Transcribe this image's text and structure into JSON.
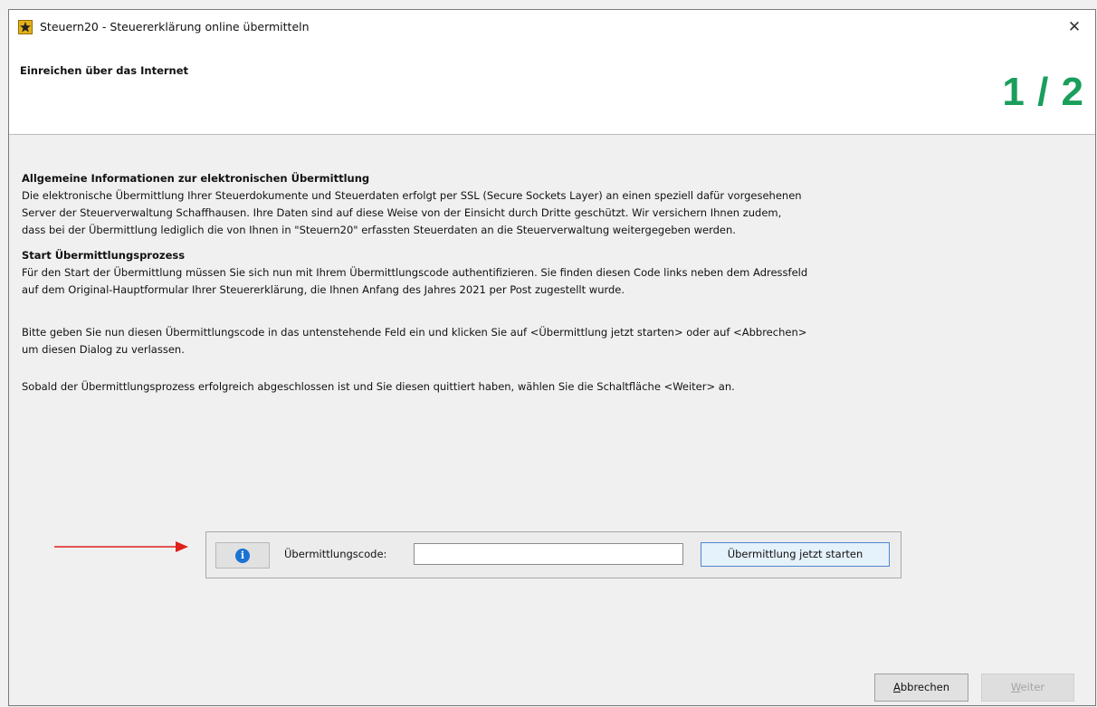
{
  "window": {
    "title": "Steuern20 - Steuererklärung online übermitteln",
    "close_label": "✕"
  },
  "header": {
    "title": "Einreichen über das Internet",
    "step": "1 / 2"
  },
  "content": {
    "section1": {
      "heading": "Allgemeine Informationen zur elektronischen Übermittlung",
      "line1": "Die elektronische Übermittlung Ihrer Steuerdokumente und Steuerdaten erfolgt per SSL (Secure Sockets Layer) an einen speziell dafür vorgesehenen",
      "line2": "Server der Steuerverwaltung Schaffhausen. Ihre Daten sind auf diese Weise von der Einsicht durch Dritte geschützt. Wir versichern Ihnen zudem,",
      "line3": "dass bei der Übermittlung lediglich die von Ihnen in \"Steuern20\" erfassten Steuerdaten an die Steuerverwaltung weitergegeben werden."
    },
    "section2": {
      "heading": "Start Übermittlungsprozess",
      "line1": "Für den Start der Übermittlung müssen Sie sich nun mit Ihrem Übermittlungscode authentifizieren. Sie finden diesen Code links neben dem Adressfeld",
      "line2": "auf dem Original-Hauptformular Ihrer Steuererklärung, die Ihnen Anfang des Jahres 2021 per Post zugestellt wurde."
    },
    "section3": {
      "line1": "Bitte geben Sie nun diesen Übermittlungscode in das untenstehende Feld ein und klicken Sie auf <Übermittlung jetzt starten> oder auf <Abbrechen>",
      "line2": "um diesen Dialog zu verlassen."
    },
    "section4": {
      "line1": "Sobald der Übermittlungsprozess erfolgreich abgeschlossen ist und Sie diesen quittiert haben, wählen Sie die Schaltfläche <Weiter> an."
    }
  },
  "code_panel": {
    "info_icon": "info-icon",
    "label": "Übermittlungscode:",
    "input_value": "",
    "start_button": "Übermittlung jetzt starten"
  },
  "footer": {
    "cancel_first": "A",
    "cancel_rest": "bbrechen",
    "next_first": "W",
    "next_rest": "eiter"
  },
  "colors": {
    "step_accent": "#1a9e5c",
    "arrow": "#e0201a",
    "start_button_border": "#4f86d0"
  }
}
